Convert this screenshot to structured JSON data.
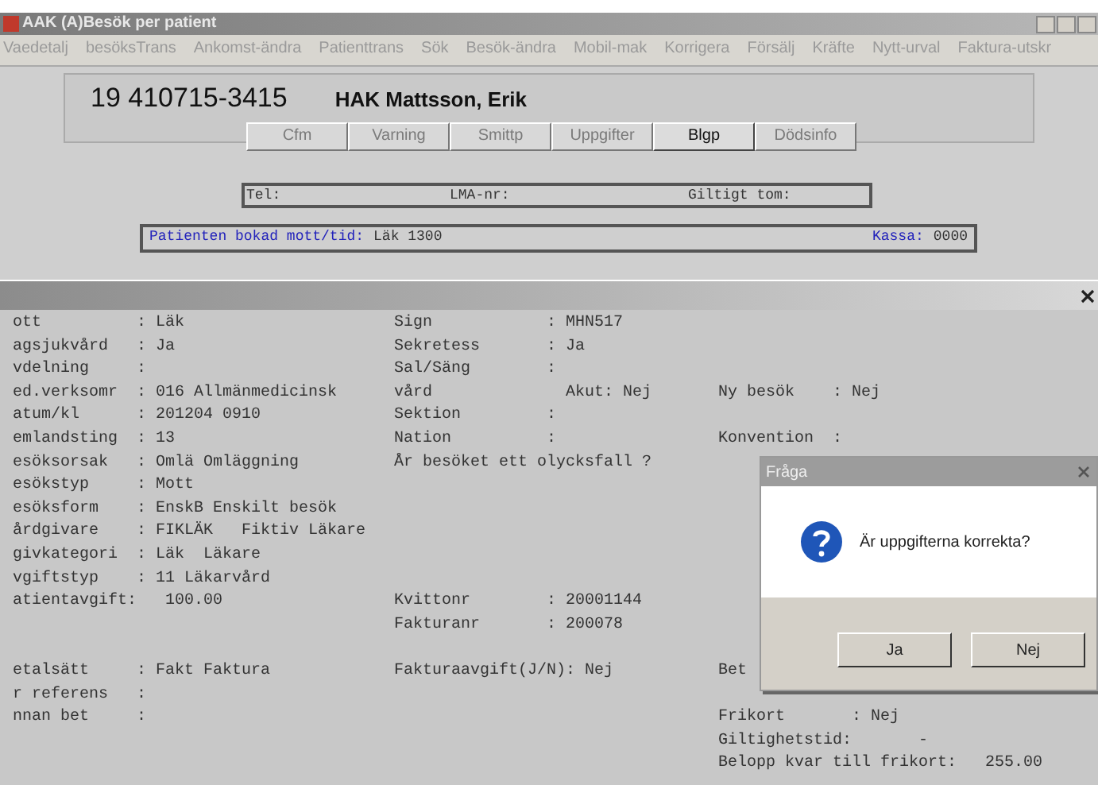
{
  "window": {
    "title": "AAK (A)Besök per patient"
  },
  "menu": [
    "Vaedetalj",
    "besöksTrans",
    "Ankomst-ändra",
    "Patienttrans",
    "Sök",
    "Besök-ändra",
    "Mobil-mak",
    "Korrigera",
    "Försälj",
    "Kräfte",
    "Nytt-urval",
    "Faktura-utskr"
  ],
  "patient": {
    "id": "19 410715-3415",
    "name": "HAK Mattsson, Erik"
  },
  "buttons": [
    {
      "label": "Cfm",
      "disabled": true
    },
    {
      "label": "Varning",
      "disabled": true
    },
    {
      "label": "Smittp",
      "disabled": true
    },
    {
      "label": "Uppgifter",
      "disabled": true
    },
    {
      "label": "Blgp",
      "disabled": false
    },
    {
      "label": "Dödsinfo",
      "disabled": true
    }
  ],
  "contact": [
    "Tel:",
    "LMA-nr:",
    "Giltigt tom:"
  ],
  "booking": {
    "label": "Patienten bokad mott/tid:",
    "value": "Läk  1300",
    "kassa_label": "Kassa:",
    "kassa": "0000"
  },
  "visit": {
    "rows": [
      {
        "left": "ott          : Läk",
        "middle": "Sign            : MHN517"
      },
      {
        "left": "agsjukvård   : Ja",
        "middle": "Sekretess       : Ja"
      },
      {
        "left": "vdelning     :",
        "middle": "Sal/Säng        :"
      },
      {
        "left": "ed.verksomr  : 016 Allmänmedicinsk",
        "middle": "vård              Akut: Nej",
        "right": "Ny besök    : Nej"
      },
      {
        "left": "atum/kl      : 201204 0910",
        "middle": "Sektion         :"
      },
      {
        "left": "emlandsting  : 13",
        "middle": "Nation          :",
        "right": "Konvention  :"
      },
      {
        "left": "esöksorsak   : Omlä Omläggning",
        "middle": "År besöket ett olycksfall ?"
      },
      {
        "left": "esökstyp     : Mott"
      },
      {
        "left": "esöksform    : EnskB Enskilt besök"
      },
      {
        "left": "årdgivare    : FIKLÄK   Fiktiv Läkare"
      },
      {
        "left": "givkategori  : Läk  Läkare"
      },
      {
        "left": "vgiftstyp    : 11 Läkarvård"
      },
      {
        "left": "atientavgift:   100.00",
        "middle": "Kvittonr        : 20001144"
      },
      {
        "middle": "Fakturanr       : 200078"
      },
      {},
      {
        "left": "etalsätt     : Fakt Faktura",
        "middle": "Fakturaavgift(J/N): Nej",
        "right": "Bet"
      },
      {
        "left": "r referens   :"
      },
      {
        "left": "nnan bet     :",
        "right": "Frikort       : Nej"
      },
      {
        "right": "Giltighetstid:       -"
      },
      {
        "right": "Belopp kvar till frikort:   255.00"
      }
    ]
  },
  "dialog": {
    "title": "Fråga",
    "message": "Är uppgifterna korrekta?",
    "buttons": [
      "Ja",
      "Nej"
    ]
  }
}
